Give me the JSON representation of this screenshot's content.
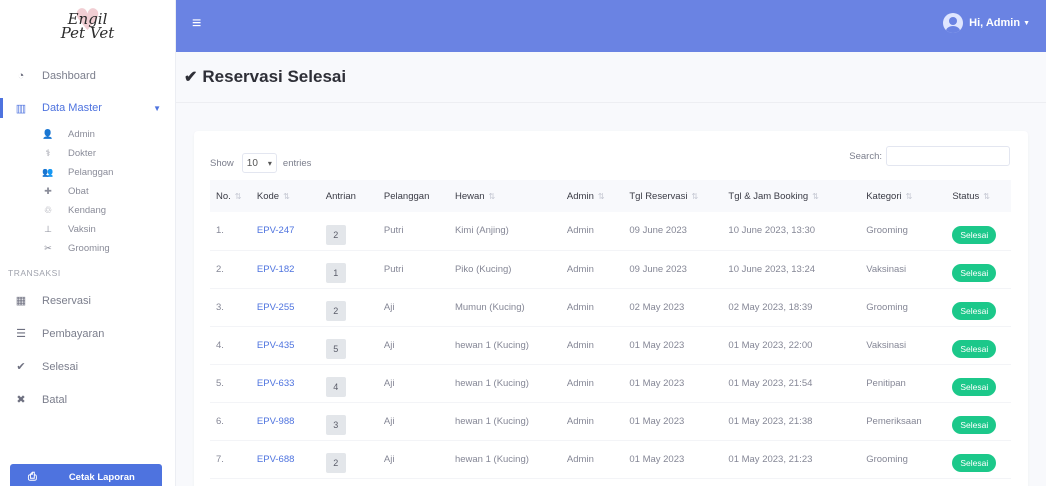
{
  "logo": {
    "line1": "Engil",
    "line2": "Pet Vet"
  },
  "sidebar": {
    "dashboard": "Dashboard",
    "data_master": "Data Master",
    "sub_items": [
      {
        "label": "Admin",
        "icon": "user-icon"
      },
      {
        "label": "Dokter",
        "icon": "doctor-icon"
      },
      {
        "label": "Pelanggan",
        "icon": "users-icon"
      },
      {
        "label": "Obat",
        "icon": "pill-icon"
      },
      {
        "label": "Kendang",
        "icon": "cage-icon"
      },
      {
        "label": "Vaksin",
        "icon": "syringe-icon"
      },
      {
        "label": "Grooming",
        "icon": "scissors-icon"
      }
    ],
    "section_transaksi": "TRANSAKSI",
    "reservasi": "Reservasi",
    "pembayaran": "Pembayaran",
    "selesai": "Selesai",
    "batal": "Batal",
    "cetak_laporan": "Cetak Laporan"
  },
  "topbar": {
    "greeting": "Hi, Admin"
  },
  "page": {
    "title": "Reservasi Selesai"
  },
  "table_controls": {
    "show": "Show",
    "entries_value": "10",
    "entries": "entries",
    "search": "Search:"
  },
  "table": {
    "headers": [
      "No.",
      "Kode",
      "Antrian",
      "Pelanggan",
      "Hewan",
      "Admin",
      "Tgl Reservasi",
      "Tgl & Jam Booking",
      "Kategori",
      "Status"
    ],
    "rows": [
      [
        "1.",
        "EPV-247",
        "2",
        "Putri",
        "Kimi (Anjing)",
        "Admin",
        "09 June 2023",
        "10 June 2023, 13:30",
        "Grooming",
        "Selesai"
      ],
      [
        "2.",
        "EPV-182",
        "1",
        "Putri",
        "Piko (Kucing)",
        "Admin",
        "09 June 2023",
        "10 June 2023, 13:24",
        "Vaksinasi",
        "Selesai"
      ],
      [
        "3.",
        "EPV-255",
        "2",
        "Aji",
        "Mumun (Kucing)",
        "Admin",
        "02 May 2023",
        "02 May 2023, 18:39",
        "Grooming",
        "Selesai"
      ],
      [
        "4.",
        "EPV-435",
        "5",
        "Aji",
        "hewan 1 (Kucing)",
        "Admin",
        "01 May 2023",
        "01 May 2023, 22:00",
        "Vaksinasi",
        "Selesai"
      ],
      [
        "5.",
        "EPV-633",
        "4",
        "Aji",
        "hewan 1 (Kucing)",
        "Admin",
        "01 May 2023",
        "01 May 2023, 21:54",
        "Penitipan",
        "Selesai"
      ],
      [
        "6.",
        "EPV-988",
        "3",
        "Aji",
        "hewan 1 (Kucing)",
        "Admin",
        "01 May 2023",
        "01 May 2023, 21:38",
        "Pemeriksaan",
        "Selesai"
      ],
      [
        "7.",
        "EPV-688",
        "2",
        "Aji",
        "hewan 1 (Kucing)",
        "Admin",
        "01 May 2023",
        "01 May 2023, 21:23",
        "Grooming",
        "Selesai"
      ]
    ]
  },
  "colors": {
    "primary": "#4e73df",
    "topbar": "#6a83e3",
    "success": "#1cc88a"
  }
}
